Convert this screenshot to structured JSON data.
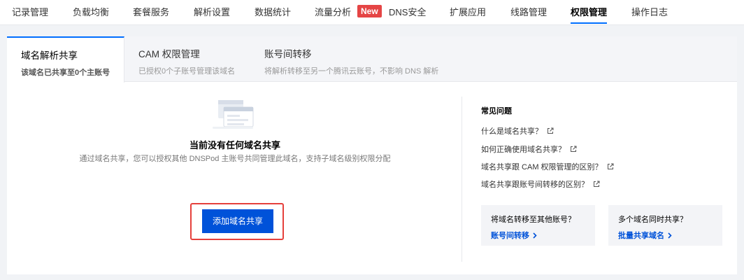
{
  "nav": {
    "items": [
      {
        "label": "记录管理"
      },
      {
        "label": "负载均衡"
      },
      {
        "label": "套餐服务"
      },
      {
        "label": "解析设置"
      },
      {
        "label": "数据统计"
      },
      {
        "label": "流量分析"
      },
      {
        "label": "DNS安全",
        "badge": "New"
      },
      {
        "label": "扩展应用"
      },
      {
        "label": "线路管理"
      },
      {
        "label": "权限管理",
        "active": true
      },
      {
        "label": "操作日志"
      }
    ]
  },
  "subtabs": [
    {
      "title": "域名解析共享",
      "desc": "该域名已共享至0个主账号",
      "active": true
    },
    {
      "title": "CAM 权限管理",
      "desc": "已授权0个子账号管理该域名"
    },
    {
      "title": "账号间转移",
      "desc": "将解析转移至另一个腾讯云账号，不影响 DNS 解析"
    }
  ],
  "empty": {
    "title": "当前没有任何域名共享",
    "desc": "通过域名共享，您可以授权其他 DNSPod 主账号共同管理此域名，支持子域名级别权限分配",
    "button": "添加域名共享"
  },
  "faq": {
    "title": "常见问题",
    "links": [
      {
        "label": "什么是域名共享？"
      },
      {
        "label": "如何正确使用域名共享？"
      },
      {
        "label": "域名共享跟 CAM 权限管理的区别？"
      },
      {
        "label": "域名共享跟账号间转移的区别？"
      }
    ]
  },
  "promos": [
    {
      "title": "将域名转移至其他账号？",
      "link": "账号间转移"
    },
    {
      "title": "多个域名同时共享？",
      "link": "批量共享域名"
    }
  ],
  "colors": {
    "primary": "#0052d9",
    "highlight": "#e5403c",
    "badge": "#e54545"
  }
}
